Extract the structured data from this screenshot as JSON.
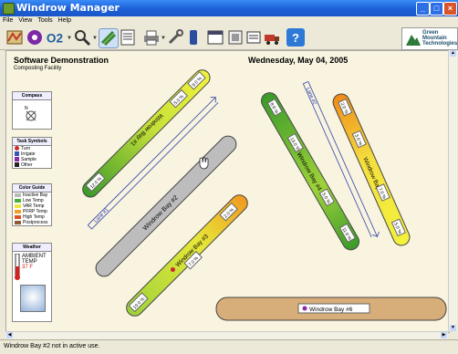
{
  "window": {
    "title": "Windrow Manager"
  },
  "menu": [
    "File",
    "View",
    "Tools",
    "Help"
  ],
  "toolbar": {
    "icons": [
      "map-icon",
      "disc-icon",
      "o2-icon",
      "magnifier-icon",
      "map-toggle-icon",
      "list-icon",
      "printer-icon",
      "tools-icon",
      "battery-icon",
      "calendar-icon",
      "notepad-icon",
      "notes-icon",
      "truck-icon",
      "help-icon"
    ],
    "o2_label": "O2"
  },
  "logo": {
    "line1": "Green",
    "line2": "Mountain",
    "line3": "Technologies"
  },
  "header": {
    "title": "Software Demonstration",
    "subtitle": "Composting Facility",
    "date": "Wednesday, May 04, 2005"
  },
  "compass": {
    "title": "Compass",
    "label": "N"
  },
  "task_symbols": {
    "title": "Task Symbols",
    "items": [
      {
        "label": "Turn",
        "color": "#cc2a2a"
      },
      {
        "label": "Irrigate",
        "color": "#3355bb"
      },
      {
        "label": "Sample",
        "color": "#8a2aaa"
      },
      {
        "label": "Other",
        "color": "#222222"
      }
    ]
  },
  "color_guide": {
    "title": "Color Guide",
    "items": [
      {
        "label": "Inactive Bay",
        "color": "#b9b9b9"
      },
      {
        "label": "Low Temp",
        "color": "#4cae3a"
      },
      {
        "label": "VAR Temp",
        "color": "#e8e838"
      },
      {
        "label": "PFRP Temp",
        "color": "#f0a020"
      },
      {
        "label": "High Temp",
        "color": "#e05020"
      },
      {
        "label": "Postprocess",
        "color": "#8a5a30"
      }
    ]
  },
  "weather": {
    "title": "Weather",
    "line1": "AMBIENT",
    "line2": "TEMP",
    "temp": "37 F"
  },
  "bays": [
    {
      "name": "Windrow Bay #1",
      "labels": [
        "9.0 %",
        "5.0 %",
        "12.0 %"
      ]
    },
    {
      "name": "Windrow Bay #2",
      "labels": []
    },
    {
      "name": "Windrow Bay #3",
      "labels": [
        "2.0 %",
        "7.0 %",
        "10.0 %"
      ]
    },
    {
      "name": "Windrow Bay #4",
      "labels": [
        "8.0 %",
        "13.0 %",
        "5.0 %",
        "11.0 %"
      ]
    },
    {
      "name": "Windrow Bay #5",
      "labels": [
        "2.0 %",
        "3.0 %",
        "7.0 %",
        "5.0 %"
      ]
    },
    {
      "name": "Windrow Bay #6",
      "labels": []
    }
  ],
  "lanes": [
    "Lane #1",
    "Lane #2"
  ],
  "status": "Windrow Bay #2 not in active use."
}
